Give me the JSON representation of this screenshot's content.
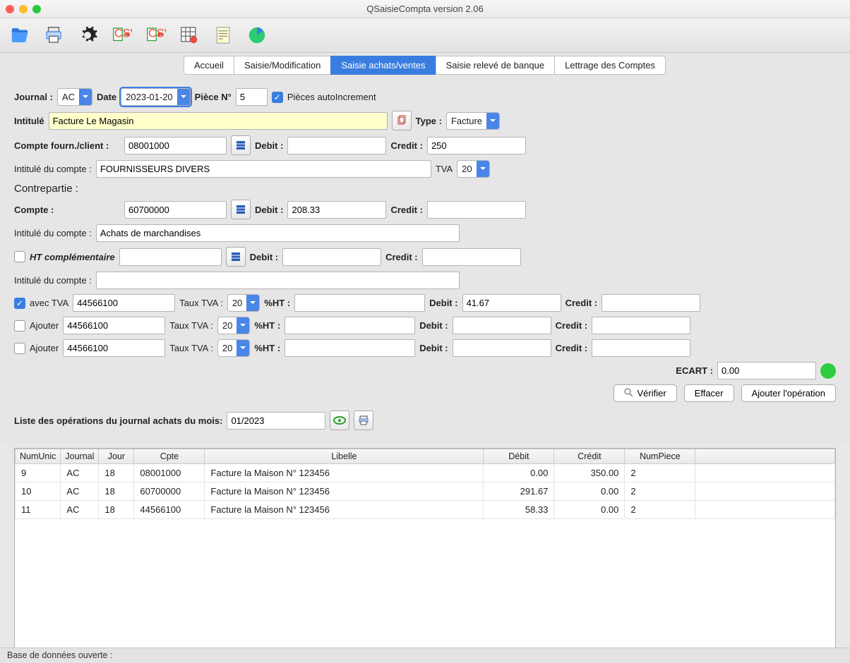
{
  "window": {
    "title": "QSaisieCompta version 2.06"
  },
  "tabs": [
    "Accueil",
    "Saisie/Modification",
    "Saisie achats/ventes",
    "Saisie relevé de banque",
    "Lettrage des Comptes"
  ],
  "active_tab": "Saisie achats/ventes",
  "header": {
    "journal_label": "Journal :",
    "journal": "AC",
    "date_label": "Date",
    "date": "2023-01-20",
    "piece_label": "Pièce N°",
    "piece": "5",
    "auto_label": "Pièces autoIncrement"
  },
  "intitule": {
    "label": "Intitulé",
    "value": "Facture Le Magasin",
    "type_label": "Type :",
    "type": "Facture"
  },
  "fournisseur": {
    "compte_label": "Compte fourn./client  :",
    "compte": "08001000",
    "debit_label": "Debit :",
    "debit": "",
    "credit_label": "Credit :",
    "credit": "250",
    "intitule_compte_label": "Intitulé du compte :",
    "intitule_compte": "FOURNISSEURS DIVERS",
    "tva_label": "TVA",
    "tva": "20"
  },
  "contrepartie": {
    "section": "Contrepartie :",
    "compte_label": "Compte  :",
    "compte": "60700000",
    "debit_label": "Debit :",
    "debit": "208.33",
    "credit_label": "Credit :",
    "credit": "",
    "intitule_compte_label": "Intitulé du compte :",
    "intitule_compte": "Achats de marchandises"
  },
  "htcomp": {
    "label": "HT complémentaire",
    "compte": "",
    "debit_label": "Debit :",
    "debit": "",
    "credit_label": "Credit :",
    "credit": "",
    "intitule_label": "Intitulé du compte :",
    "intitule": ""
  },
  "tva_lines": [
    {
      "checked": true,
      "label": "avec TVA",
      "compte": "44566100",
      "taux_label": "Taux TVA :",
      "taux": "20",
      "pcht": "%HT :",
      "ht": "",
      "debit_label": "Debit :",
      "debit": "41.67",
      "credit_label": "Credit :",
      "credit": ""
    },
    {
      "checked": false,
      "label": "Ajouter",
      "compte": "44566100",
      "taux_label": "Taux TVA :",
      "taux": "20",
      "pcht": "%HT :",
      "ht": "",
      "debit_label": "Debit :",
      "debit": "",
      "credit_label": "Credit :",
      "credit": ""
    },
    {
      "checked": false,
      "label": "Ajouter",
      "compte": "44566100",
      "taux_label": "Taux TVA :",
      "taux": "20",
      "pcht": "%HT :",
      "ht": "",
      "debit_label": "Debit :",
      "debit": "",
      "credit_label": "Credit :",
      "credit": ""
    }
  ],
  "ecart": {
    "label": "ECART :",
    "value": "0.00"
  },
  "buttons": {
    "verifier": "Vérifier",
    "effacer": "Effacer",
    "ajouter": "Ajouter l'opération"
  },
  "list_label": "Liste des opérations du journal achats du mois:",
  "list_month": "01/2023",
  "table": {
    "headers": [
      "NumUnic",
      "Journal",
      "Jour",
      "Cpte",
      "Libelle",
      "Débit",
      "Crédit",
      "NumPiece"
    ],
    "rows": [
      [
        "9",
        "AC",
        "18",
        "08001000",
        "Facture la Maison N° 123456",
        "0.00",
        "350.00",
        "2"
      ],
      [
        "10",
        "AC",
        "18",
        "60700000",
        "Facture la Maison N° 123456",
        "291.67",
        "0.00",
        "2"
      ],
      [
        "11",
        "AC",
        "18",
        "44566100",
        "Facture la Maison N° 123456",
        "58.33",
        "0.00",
        "2"
      ]
    ]
  },
  "status": "Base de données ouverte :"
}
